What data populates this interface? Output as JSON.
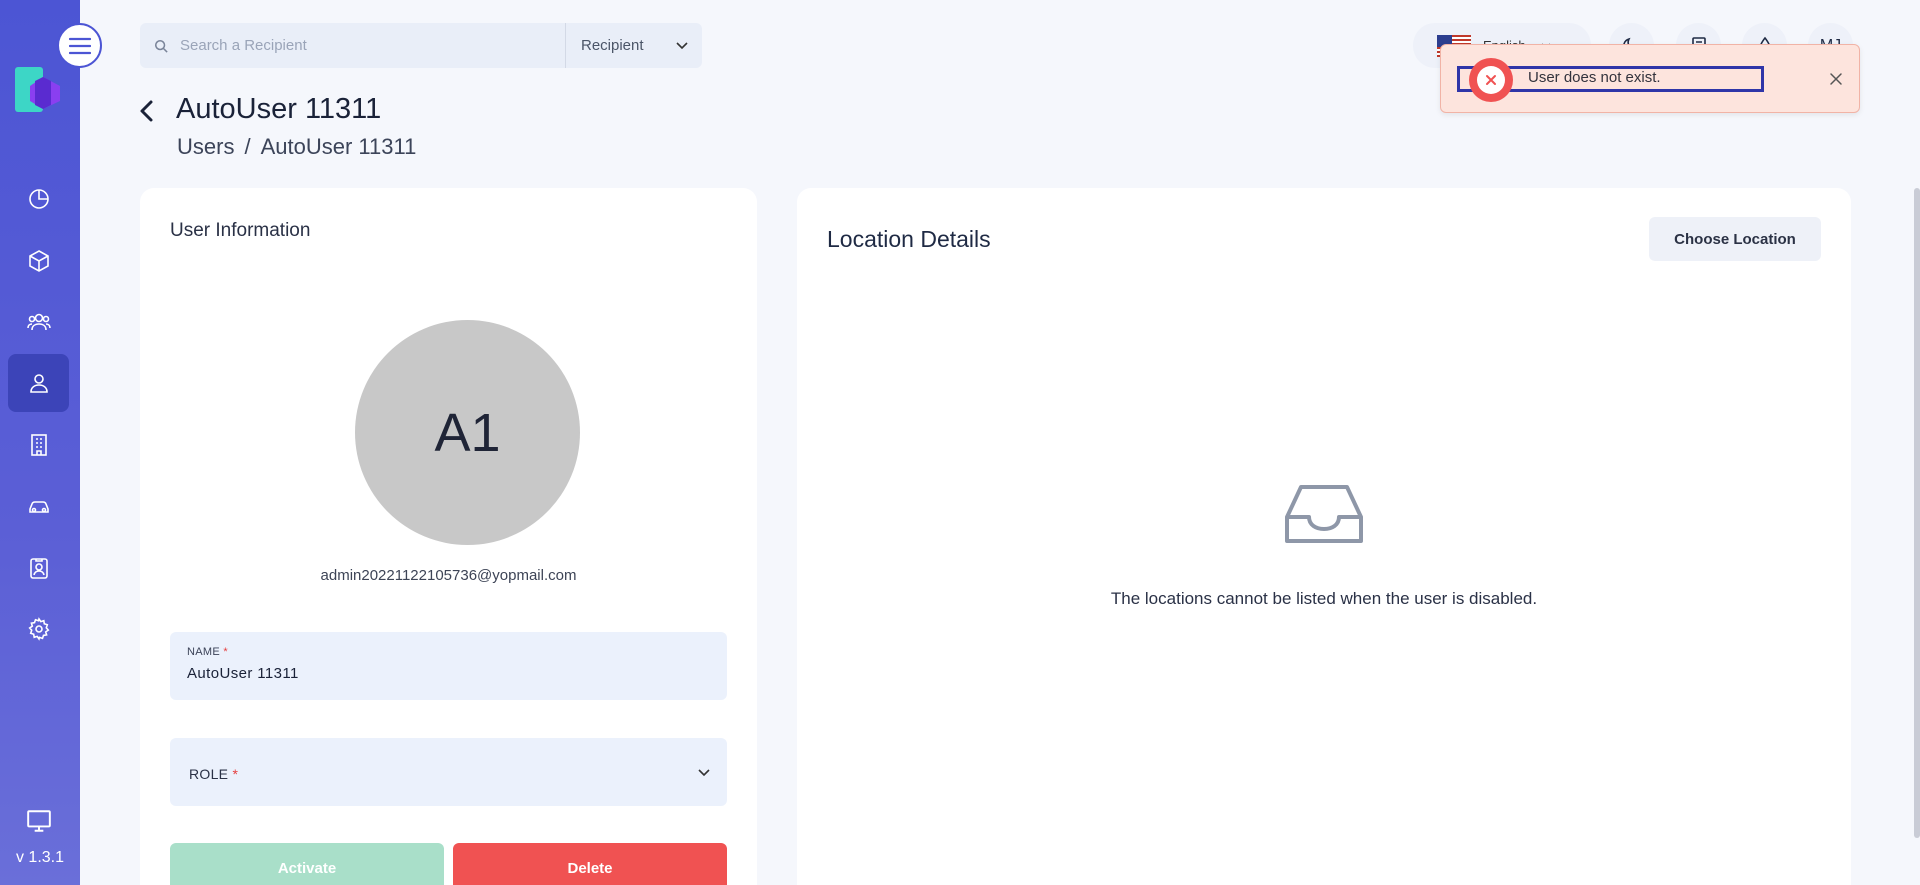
{
  "topbar": {
    "search_placeholder": "Search a Recipient",
    "search_type": "Recipient",
    "language": "English",
    "user_initials": "MJ"
  },
  "toast": {
    "message": "User does not exist.",
    "type": "error"
  },
  "header": {
    "title": "AutoUser 11311",
    "breadcrumb": [
      "Users",
      "AutoUser 11311"
    ]
  },
  "sidebar": {
    "items": [
      {
        "name": "dashboard",
        "icon": "pie-chart-icon",
        "active": false
      },
      {
        "name": "packages",
        "icon": "cube-icon",
        "active": false
      },
      {
        "name": "recipients",
        "icon": "group-icon",
        "active": false
      },
      {
        "name": "users",
        "icon": "user-icon",
        "active": true
      },
      {
        "name": "buildings",
        "icon": "building-icon",
        "active": false
      },
      {
        "name": "vehicles",
        "icon": "car-icon",
        "active": false
      },
      {
        "name": "contacts",
        "icon": "badge-icon",
        "active": false
      },
      {
        "name": "settings",
        "icon": "gear-icon",
        "active": false
      }
    ],
    "version": "v 1.3.1"
  },
  "user_info": {
    "title": "User Information",
    "avatar_initials": "A1",
    "email": "admin20221122105736@yopmail.com",
    "name_label": "NAME",
    "name_value": "AutoUser 11311",
    "role_label": "ROLE",
    "role_value": "",
    "activate_label": "Activate",
    "delete_label": "Delete"
  },
  "location": {
    "title": "Location Details",
    "choose_label": "Choose Location",
    "empty_message": "The locations cannot be listed when the user is disabled."
  },
  "colors": {
    "sidebar": "#4c55d4",
    "error": "#f05252",
    "activate": "#a9dfc9",
    "field_bg": "#ebf1fc"
  }
}
